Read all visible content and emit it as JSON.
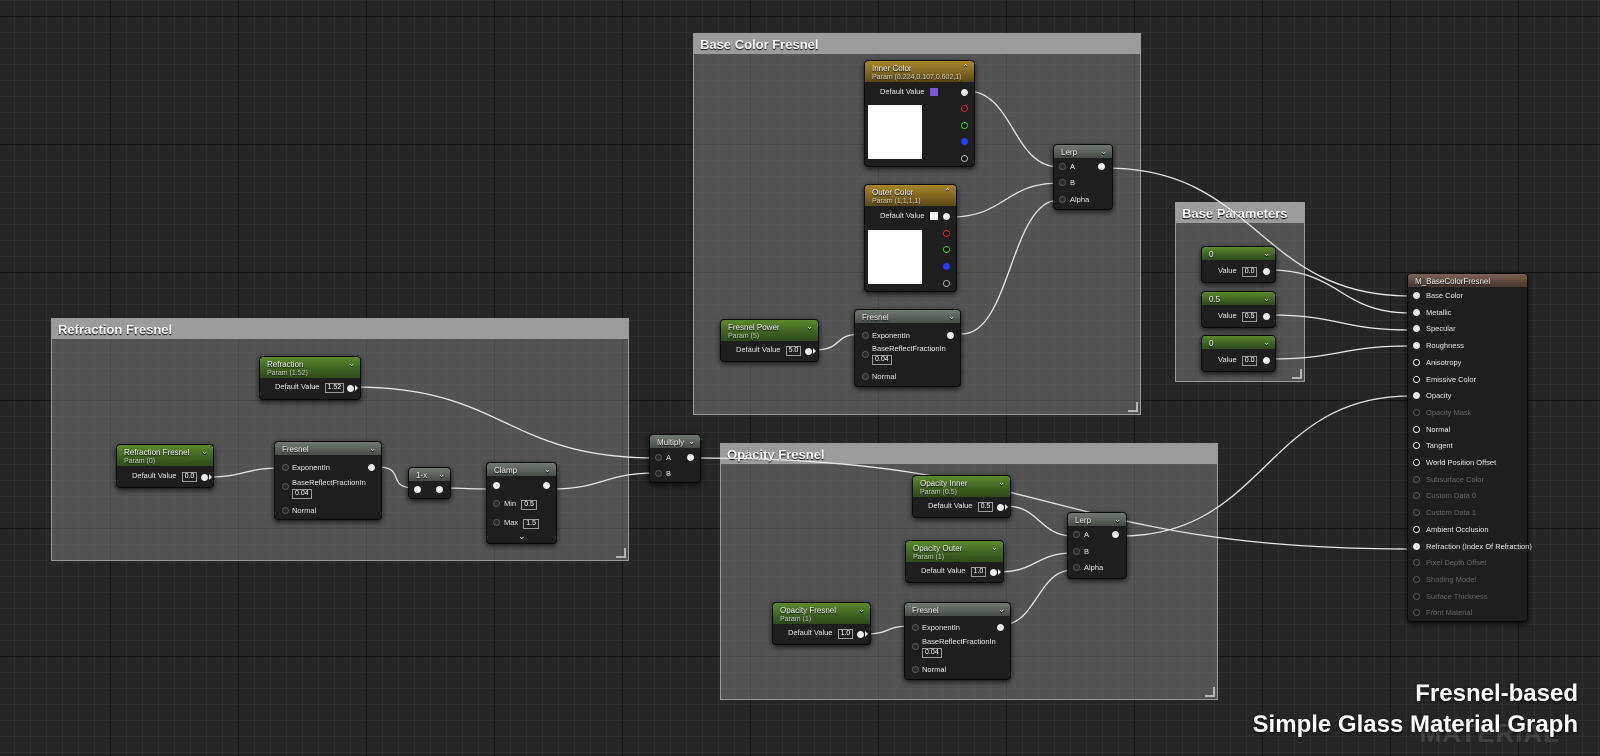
{
  "comments": {
    "refraction": "Refraction Fresnel",
    "base_color": "Base Color Fresnel",
    "opacity": "Opacity Fresnel",
    "base_params": "Base Parameters"
  },
  "common": {
    "default_value": "Default Value",
    "value": "Value",
    "exponent_in": "ExponentIn",
    "base_reflect": "BaseReflectFractionIn",
    "base_reflect_value": "0.04",
    "normal": "Normal",
    "a": "A",
    "b": "B",
    "alpha": "Alpha",
    "min": "Min",
    "max": "Max",
    "fresnel": "Fresnel",
    "lerp": "Lerp"
  },
  "refraction_group": {
    "refraction": {
      "title": "Refraction",
      "subtitle": "Param (1.52)",
      "value": "1.52"
    },
    "refraction_fresnel": {
      "title": "Refraction Fresnel",
      "subtitle": "Param (0)",
      "value": "0.0"
    },
    "one_minus": {
      "title": "1-x"
    },
    "clamp": {
      "title": "Clamp",
      "min": "0.5",
      "max": "1.5"
    }
  },
  "multiply": {
    "title": "Multiply"
  },
  "base_color_group": {
    "inner_color": {
      "title": "Inner Color",
      "subtitle": "Param (0.224,0.107,0.602,1)",
      "swatch": "#7a58d8"
    },
    "outer_color": {
      "title": "Outer Color",
      "subtitle": "Param (1,1,1,1)",
      "swatch": "#ffffff"
    },
    "fresnel_power": {
      "title": "Fresnel Power",
      "subtitle": "Param (5)",
      "value": "5.0"
    }
  },
  "opacity_group": {
    "opacity_inner": {
      "title": "Opacity Inner",
      "subtitle": "Param (0.5)",
      "value": "0.5"
    },
    "opacity_outer": {
      "title": "Opacity Outer",
      "subtitle": "Param (1)",
      "value": "1.0"
    },
    "opacity_fresnel": {
      "title": "Opacity Fresnel",
      "subtitle": "Param (1)",
      "value": "1.0"
    }
  },
  "base_params_group": {
    "c1": {
      "title": "0",
      "value": "0.0"
    },
    "c2": {
      "title": "0.5",
      "value": "0.5"
    },
    "c3": {
      "title": "0",
      "value": "0.0"
    }
  },
  "material": {
    "title": "M_BaseColorFresnel",
    "inputs": [
      {
        "label": "Base Color",
        "enabled": true,
        "connected": true
      },
      {
        "label": "Metallic",
        "enabled": true,
        "connected": true
      },
      {
        "label": "Specular",
        "enabled": true,
        "connected": true
      },
      {
        "label": "Roughness",
        "enabled": true,
        "connected": true
      },
      {
        "label": "Anisotropy",
        "enabled": true,
        "connected": false
      },
      {
        "label": "Emissive Color",
        "enabled": true,
        "connected": false
      },
      {
        "label": "Opacity",
        "enabled": true,
        "connected": true
      },
      {
        "label": "Opacity Mask",
        "enabled": false,
        "connected": false
      },
      {
        "label": "Normal",
        "enabled": true,
        "connected": false
      },
      {
        "label": "Tangent",
        "enabled": true,
        "connected": false
      },
      {
        "label": "World Position Offset",
        "enabled": true,
        "connected": false
      },
      {
        "label": "Subsurface Color",
        "enabled": false,
        "connected": false
      },
      {
        "label": "Custom Data 0",
        "enabled": false,
        "connected": false
      },
      {
        "label": "Custom Data 1",
        "enabled": false,
        "connected": false
      },
      {
        "label": "Ambient Occlusion",
        "enabled": true,
        "connected": false
      },
      {
        "label": "Refraction (Index Of Refraction)",
        "enabled": true,
        "connected": true
      },
      {
        "label": "Pixel Depth Offset",
        "enabled": false,
        "connected": false
      },
      {
        "label": "Shading Model",
        "enabled": false,
        "connected": false
      },
      {
        "label": "Surface Thickness",
        "enabled": false,
        "connected": false
      },
      {
        "label": "Front Material",
        "enabled": false,
        "connected": false
      }
    ]
  },
  "caption": {
    "line1": "Fresnel-based",
    "line2": "Simple Glass Material Graph"
  },
  "watermark": "MATERIAL",
  "colors": {
    "wire": "#e8e8e8",
    "param_header": "#4f7a28",
    "vector_header": "#8a6e22"
  }
}
